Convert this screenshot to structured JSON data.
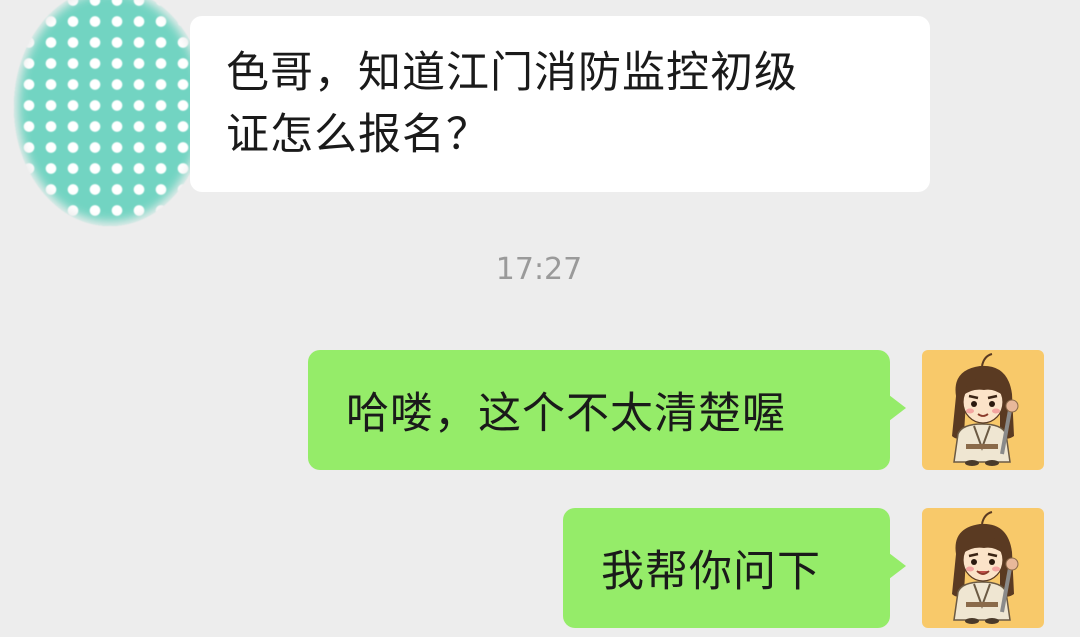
{
  "messages": [
    {
      "direction": "incoming",
      "text_line1": "色哥，知道江门消防监控初级",
      "text_line2": "证怎么报名？",
      "avatar": "polka-dot-avatar-icon"
    },
    {
      "direction": "outgoing",
      "text": "哈喽，这个不太清楚喔",
      "avatar": "cartoon-character-avatar-icon"
    },
    {
      "direction": "outgoing",
      "text": "我帮你问下",
      "avatar": "cartoon-character-avatar-icon"
    }
  ],
  "timestamp": "17:27",
  "colors": {
    "background": "#ededed",
    "incoming_bubble": "#ffffff",
    "outgoing_bubble": "#95ec69",
    "avatar_background": "#f8c96a",
    "incoming_avatar": "#72d4c2",
    "timestamp_text": "#9a9a9a"
  }
}
